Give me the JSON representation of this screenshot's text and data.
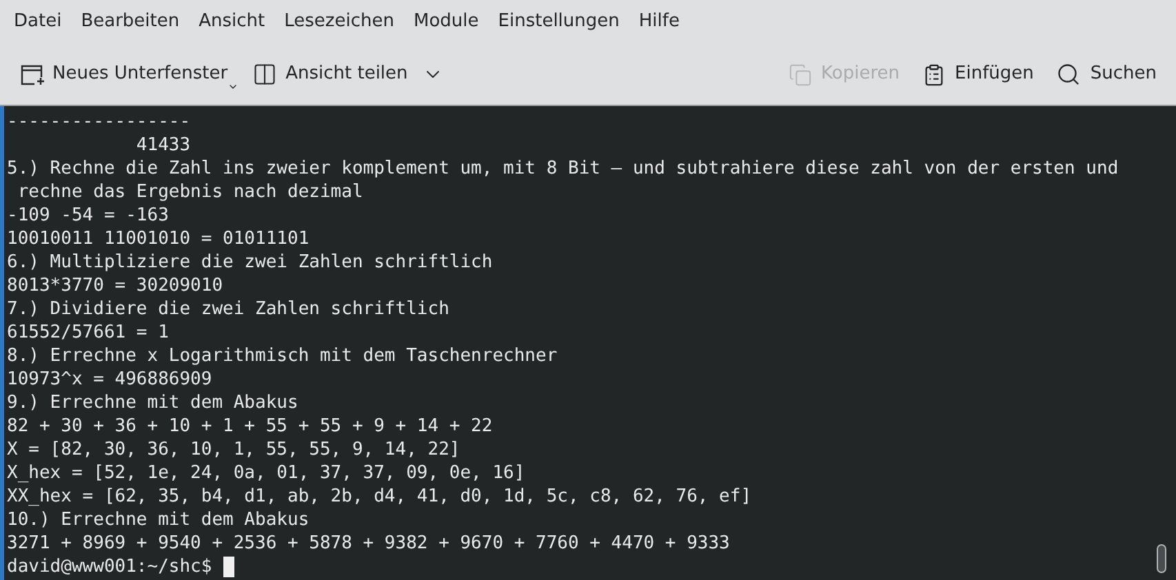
{
  "menu_bar": [
    "Datei",
    "Bearbeiten",
    "Ansicht",
    "Lesezeichen",
    "Module",
    "Einstellungen",
    "Hilfe"
  ],
  "toolbar": {
    "left": [
      {
        "label": "Neues Unterfenster",
        "disabled": false
      },
      {
        "label": "Ansicht teilen",
        "disabled": false
      }
    ],
    "right": [
      {
        "label": "Kopieren",
        "disabled": true
      },
      {
        "label": "Einfügen",
        "disabled": false
      },
      {
        "label": "Suchen",
        "disabled": false
      }
    ]
  },
  "terminal": {
    "lines": [
      "-----------------",
      "            41433",
      "5.) Rechne die Zahl ins zweier komplement um, mit 8 Bit – und subtrahiere diese zahl von der ersten und",
      " rechne das Ergebnis nach dezimal",
      "-109 -54 = -163",
      "10010011 11001010 = 01011101",
      "6.) Multipliziere die zwei Zahlen schriftlich",
      "8013*3770 = 30209010",
      "7.) Dividiere die zwei Zahlen schriftlich",
      "61552/57661 = 1",
      "8.) Errechne x Logarithmisch mit dem Taschenrechner",
      "10973^x = 496886909",
      "9.) Errechne mit dem Abakus",
      "82 + 30 + 36 + 10 + 1 + 55 + 55 + 9 + 14 + 22",
      "X = [82, 30, 36, 10, 1, 55, 55, 9, 14, 22]",
      "X_hex = [52, 1e, 24, 0a, 01, 37, 37, 09, 0e, 16]",
      "XX_hex = [62, 35, b4, d1, ab, 2b, d4, 41, d0, 1d, 5c, c8, 62, 76, ef]",
      "10.) Errechne mit dem Abakus",
      "3271 + 8969 + 9540 + 2536 + 5878 + 9382 + 9670 + 7760 + 4470 + 9333"
    ],
    "prompt": "david@www001:~/shc$ "
  }
}
